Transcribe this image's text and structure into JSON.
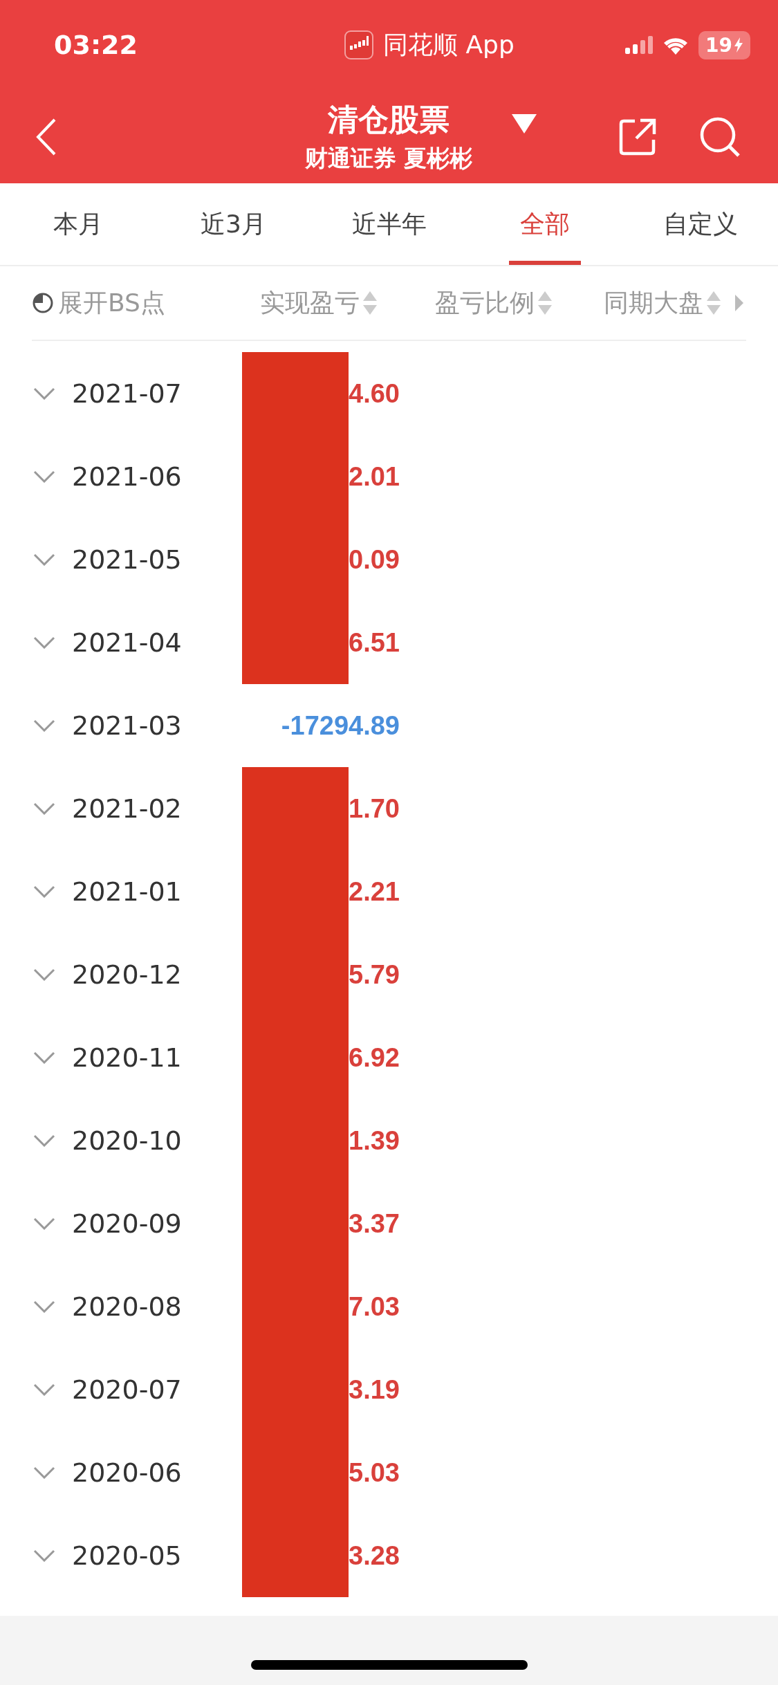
{
  "status_bar": {
    "time": "03:22",
    "app": "同花顺 App",
    "battery": "19"
  },
  "header": {
    "title": "清仓股票",
    "subtitle": "财通证券 夏彬彬"
  },
  "tabs": [
    {
      "label": "本月",
      "selected": false
    },
    {
      "label": "近3月",
      "selected": false
    },
    {
      "label": "近半年",
      "selected": false
    },
    {
      "label": "全部",
      "selected": true
    },
    {
      "label": "自定义",
      "selected": false
    }
  ],
  "columns": {
    "toggle": "展开BS点",
    "sortable": [
      "实现盈亏",
      "盈亏比例",
      "同期大盘"
    ]
  },
  "rows": [
    {
      "month": "2021-07",
      "value": "4.60",
      "color": "#d9403b",
      "redacted": true
    },
    {
      "month": "2021-06",
      "value": "2.01",
      "color": "#d9403b",
      "redacted": true
    },
    {
      "month": "2021-05",
      "value": "0.09",
      "color": "#d9403b",
      "redacted": true
    },
    {
      "month": "2021-04",
      "value": "6.51",
      "color": "#d9403b",
      "redacted": true
    },
    {
      "month": "2021-03",
      "value": "-17294.89",
      "color": "#4a8fdc",
      "redacted": false
    },
    {
      "month": "2021-02",
      "value": "1.70",
      "color": "#d9403b",
      "redacted": true
    },
    {
      "month": "2021-01",
      "value": "2.21",
      "color": "#d9403b",
      "redacted": true
    },
    {
      "month": "2020-12",
      "value": "5.79",
      "color": "#d9403b",
      "redacted": true
    },
    {
      "month": "2020-11",
      "value": "6.92",
      "color": "#d9403b",
      "redacted": true
    },
    {
      "month": "2020-10",
      "value": "1.39",
      "color": "#d9403b",
      "redacted": true
    },
    {
      "month": "2020-09",
      "value": "3.37",
      "color": "#d9403b",
      "redacted": true
    },
    {
      "month": "2020-08",
      "value": "7.03",
      "color": "#d9403b",
      "redacted": true
    },
    {
      "month": "2020-07",
      "value": "3.19",
      "color": "#d9403b",
      "redacted": true
    },
    {
      "month": "2020-06",
      "value": "5.03",
      "color": "#d9403b",
      "redacted": true
    },
    {
      "month": "2020-05",
      "value": "3.28",
      "color": "#d9403b",
      "redacted": true
    }
  ]
}
